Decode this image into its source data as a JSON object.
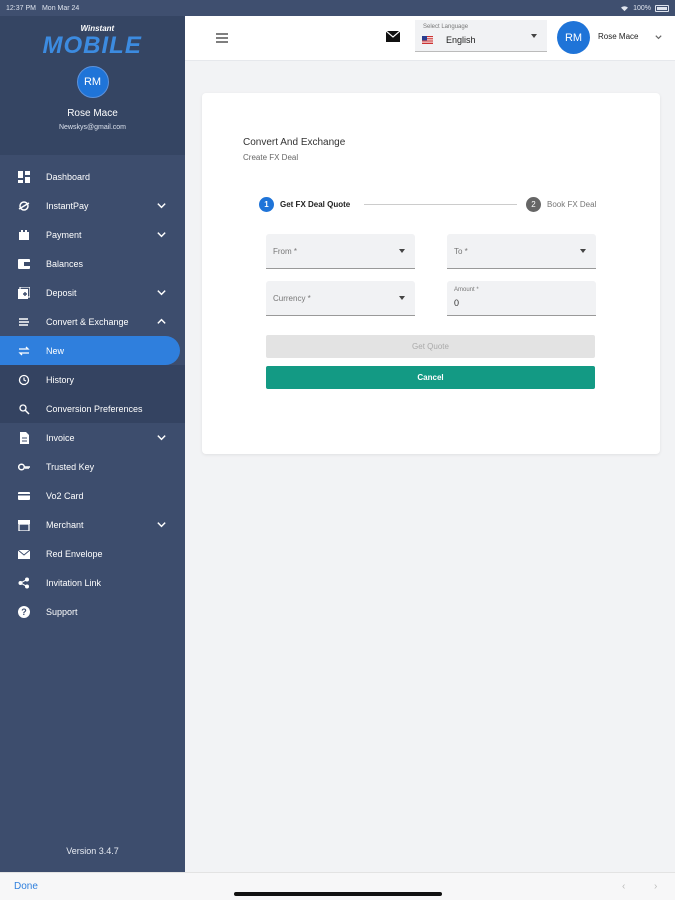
{
  "status_bar": {
    "time": "12:37 PM",
    "date": "Mon Mar 24",
    "battery": "100%"
  },
  "sidebar": {
    "logo_small": "Winstant",
    "logo_big": "MOBILE",
    "avatar_initials": "RM",
    "user_name": "Rose Mace",
    "user_email": "Newskys@gmail.com",
    "items": [
      {
        "label": "Dashboard",
        "icon": "dashboard-icon",
        "expandable": false
      },
      {
        "label": "InstantPay",
        "icon": "instantpay-icon",
        "expandable": true
      },
      {
        "label": "Payment",
        "icon": "payment-icon",
        "expandable": true
      },
      {
        "label": "Balances",
        "icon": "balances-icon",
        "expandable": false
      },
      {
        "label": "Deposit",
        "icon": "deposit-icon",
        "expandable": true
      },
      {
        "label": "Convert & Exchange",
        "icon": "convert-icon",
        "expandable": true,
        "expanded": true
      },
      {
        "label": "New",
        "icon": "swap-icon",
        "sub": true,
        "active": true
      },
      {
        "label": "History",
        "icon": "history-icon",
        "sub": true
      },
      {
        "label": "Conversion Preferences",
        "icon": "preferences-icon",
        "sub": true
      },
      {
        "label": "Invoice",
        "icon": "invoice-icon",
        "expandable": true
      },
      {
        "label": "Trusted Key",
        "icon": "key-icon",
        "expandable": false
      },
      {
        "label": "Vo2 Card",
        "icon": "card-icon",
        "expandable": false
      },
      {
        "label": "Merchant",
        "icon": "merchant-icon",
        "expandable": true
      },
      {
        "label": "Red Envelope",
        "icon": "envelope-icon",
        "expandable": false
      },
      {
        "label": "Invitation Link",
        "icon": "share-icon",
        "expandable": false
      },
      {
        "label": "Support",
        "icon": "help-icon",
        "expandable": false
      }
    ],
    "version": "Version 3.4.7"
  },
  "topbar": {
    "language_label": "Select Language",
    "language_value": "English",
    "avatar_initials": "RM",
    "user_name": "Rose Mace"
  },
  "main": {
    "title": "Convert And Exchange",
    "subtitle": "Create FX Deal",
    "steps": [
      {
        "number": "1",
        "label": "Get FX Deal Quote"
      },
      {
        "number": "2",
        "label": "Book FX Deal"
      }
    ],
    "fields": {
      "from_label": "From *",
      "to_label": "To *",
      "currency_label": "Currency *",
      "amount_label": "Amount *",
      "amount_value": "0"
    },
    "get_quote_label": "Get Quote",
    "cancel_label": "Cancel"
  },
  "bottom_bar": {
    "done_label": "Done",
    "prev_arrow": "‹",
    "next_arrow": "›"
  },
  "colors": {
    "sidebar": "#3d4d6d",
    "active": "#2f7fdd",
    "cancel": "#139a84",
    "avatar": "#1f74d8"
  }
}
